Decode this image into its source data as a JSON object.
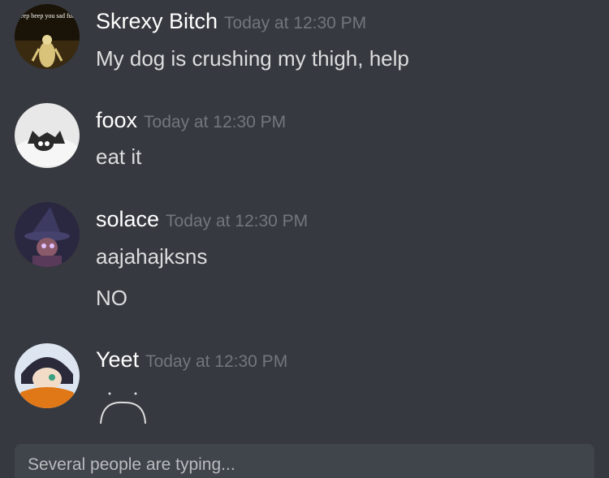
{
  "messages": [
    {
      "username": "Skrexy Bitch",
      "timestamp": "Today at 12:30 PM",
      "avatar_text": "Beep beep you sad fuck",
      "lines": [
        "My dog is crushing my thigh, help"
      ]
    },
    {
      "username": "foox",
      "timestamp": "Today at 12:30 PM",
      "lines": [
        "eat it"
      ]
    },
    {
      "username": "solace",
      "timestamp": "Today at 12:30 PM",
      "lines": [
        "aajahajksns",
        "NO"
      ]
    },
    {
      "username": "Yeet",
      "timestamp": "Today at 12:30 PM",
      "lines": []
    }
  ],
  "typing": {
    "text": "Several people are typing..."
  },
  "colors": {
    "background": "#36393f",
    "username": "#ffffff",
    "timestamp": "#72767d",
    "message_text": "#dcddde",
    "input_bg": "#40444b"
  }
}
